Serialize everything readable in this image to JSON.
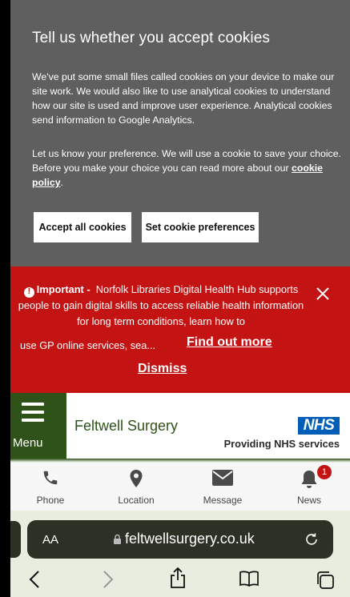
{
  "cookie_banner": {
    "title": "Tell us whether you accept cookies",
    "paragraph1": "We've put some small files called cookies on your device to make our site work. We would also like to use analytical cookies to understand how our site is used and improve user experience. Analytical cookies send information to Google Analytics.",
    "paragraph2_text": "Let us know your preference. We will use a cookie to save your choice. Before you make your choice you can read more about our ",
    "policy_link": "cookie policy",
    "paragraph2_end": ".",
    "accept_label": "Accept all cookies",
    "prefs_label": "Set cookie preferences"
  },
  "alert": {
    "icon": "exclamation-circle-icon",
    "lead": "Important -",
    "message": "Norfolk Libraries Digital Health Hub supports people to gain digital skills to access reliable health information for long term conditions, learn how to",
    "truncated": "use GP online services, sea...",
    "find_out_more": "Find out more",
    "dismiss": "Dismiss",
    "close_icon": "close-icon"
  },
  "header": {
    "menu_label": "Menu",
    "site_name": "Feltwell Surgery",
    "nhs_logo": "NHS",
    "nhs_tagline": "Providing NHS services"
  },
  "quick_nav": [
    {
      "label": "Phone",
      "icon": "phone-icon"
    },
    {
      "label": "Location",
      "icon": "map-pin-icon"
    },
    {
      "label": "Message",
      "icon": "envelope-icon"
    },
    {
      "label": "News",
      "icon": "bell-icon",
      "badge": "1"
    }
  ],
  "browser": {
    "aa_label": "AA",
    "url": "feltwellsurgery.co.uk"
  },
  "colors": {
    "banner_grey": "#5f5f5f",
    "alert_red": "#c41313",
    "brand_green": "#2e5218",
    "nhs_blue": "#005eb8"
  }
}
